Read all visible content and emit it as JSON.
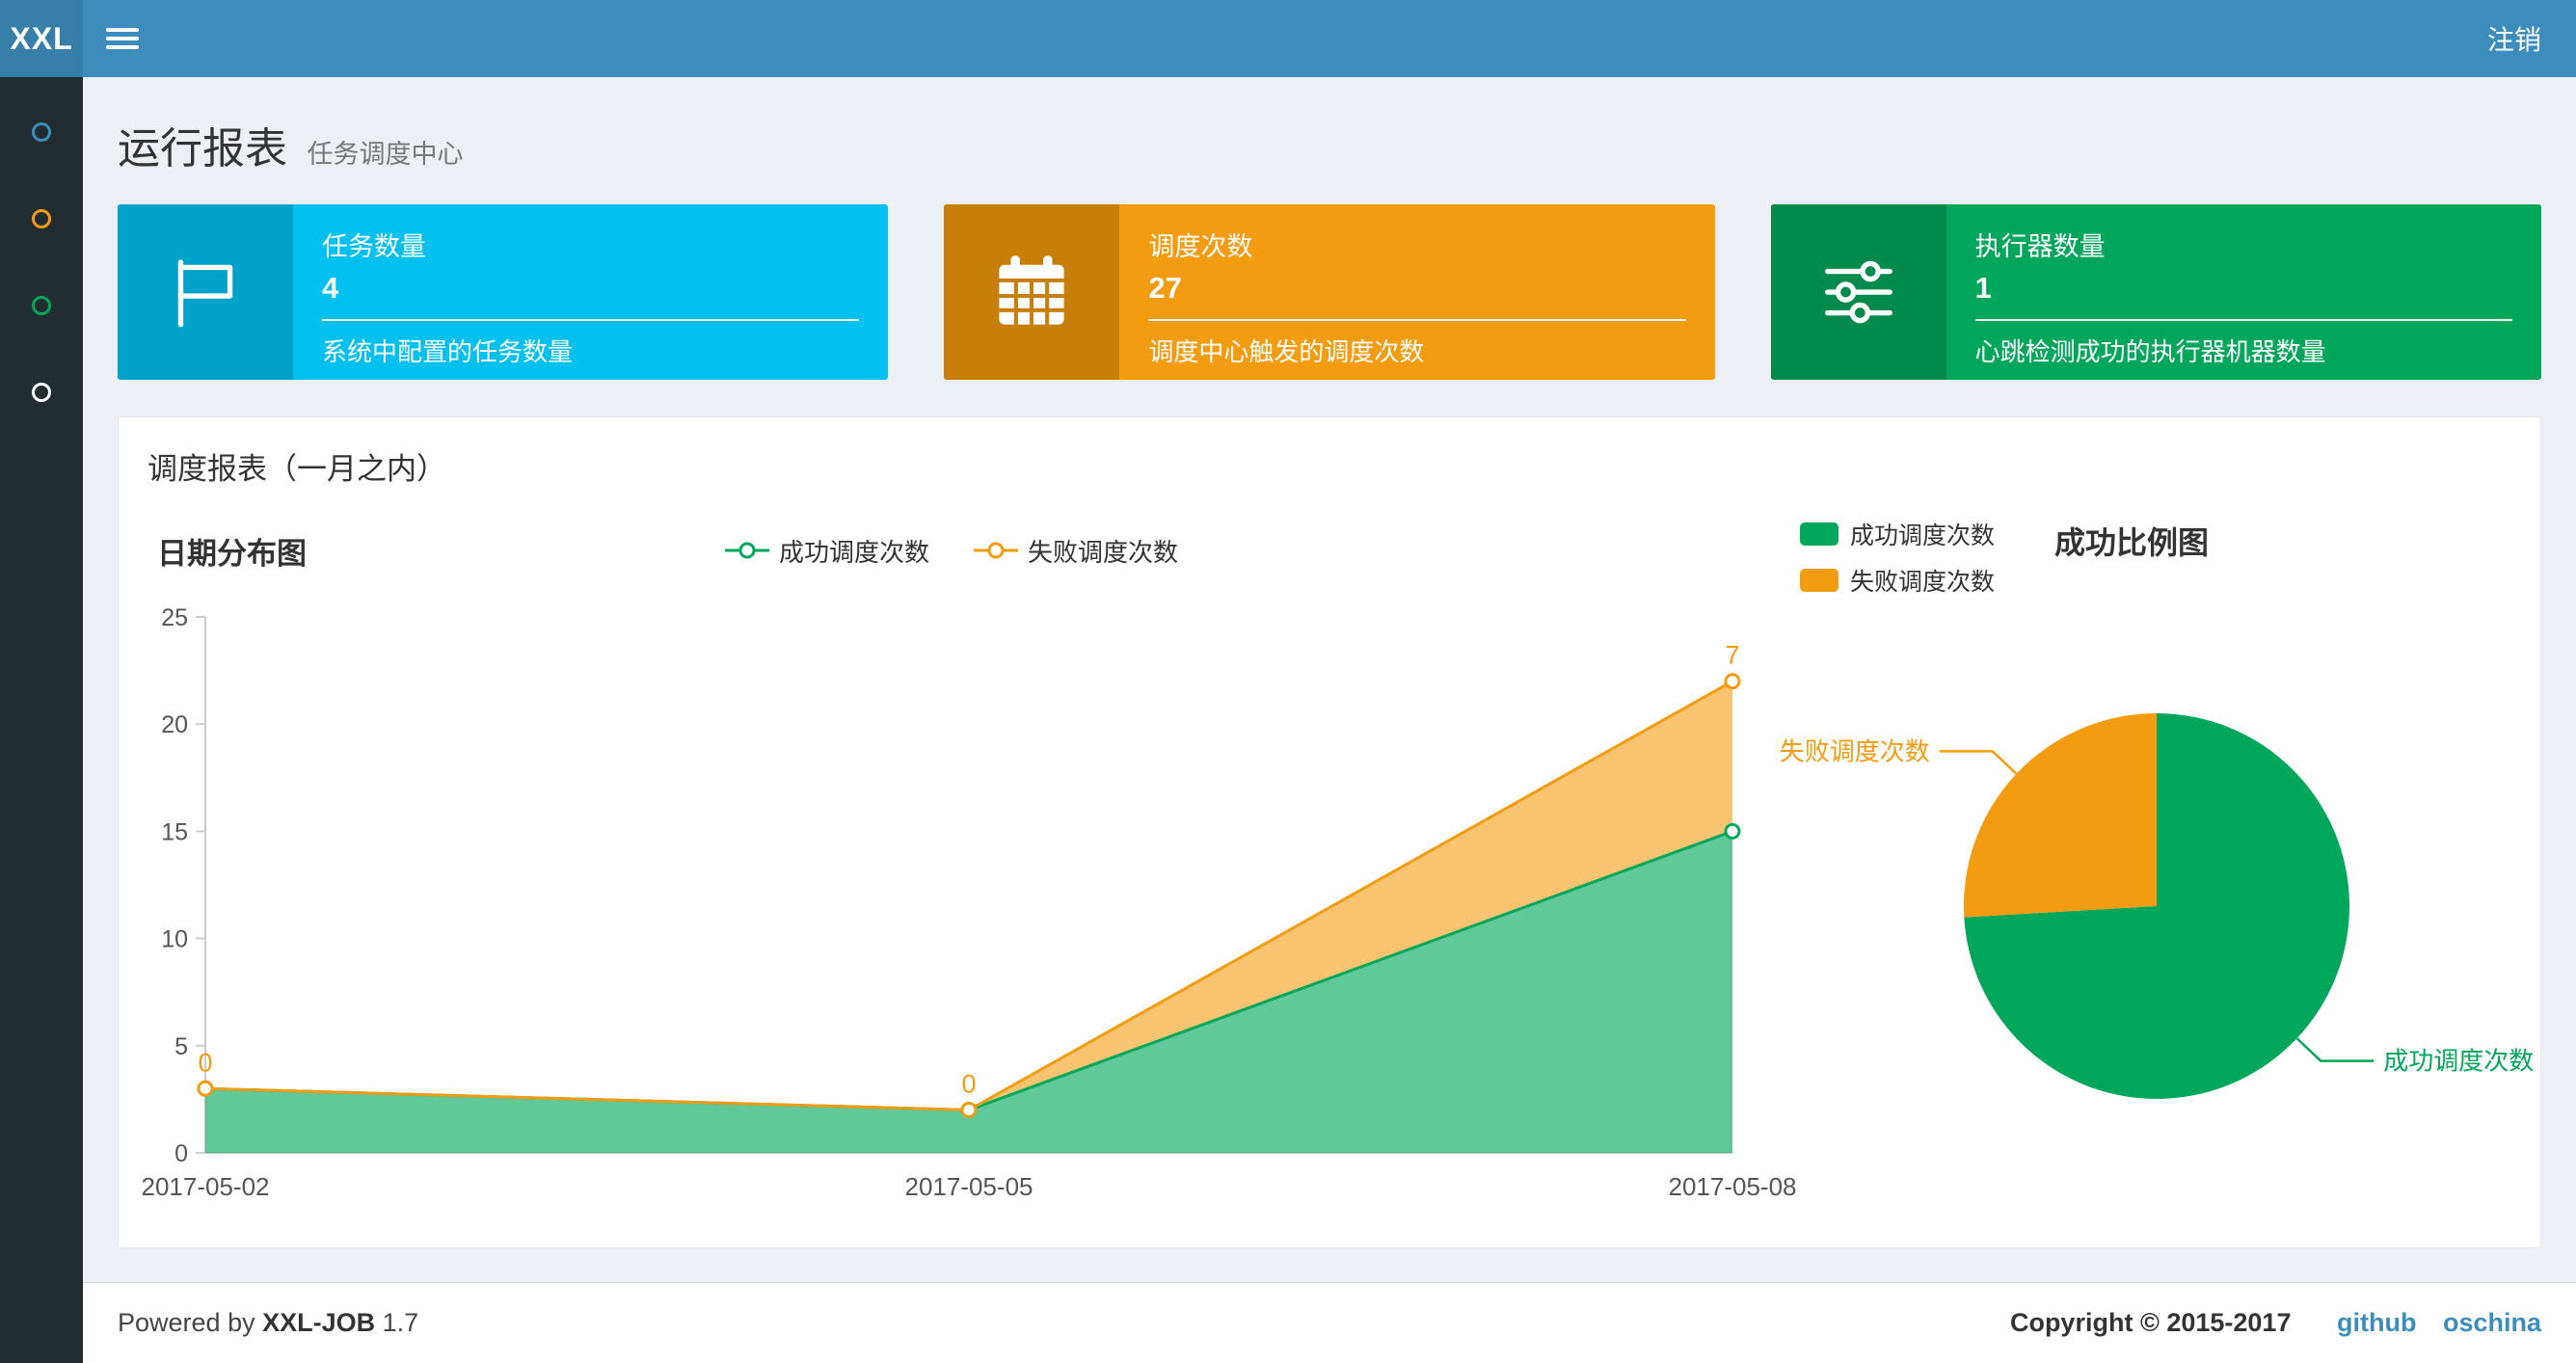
{
  "navbar": {
    "logo": "XXL",
    "logout_label": "注销"
  },
  "sidebar": {
    "items": [
      {
        "id": "menu-1",
        "color": "#3c8dbc"
      },
      {
        "id": "menu-2",
        "color": "#f39c12"
      },
      {
        "id": "menu-3",
        "color": "#00a65a"
      },
      {
        "id": "menu-4",
        "color": "#ffffff"
      }
    ]
  },
  "header": {
    "title": "运行报表",
    "subtitle": "任务调度中心"
  },
  "info_boxes": [
    {
      "label": "任务数量",
      "value": "4",
      "desc": "系统中配置的任务数量",
      "color": "#00c0ef",
      "color_dark": "#00a2ca",
      "icon": "flag-icon"
    },
    {
      "label": "调度次数",
      "value": "27",
      "desc": "调度中心触发的调度次数",
      "color": "#f39c12",
      "color_dark": "#c87f0a",
      "icon": "calendar-icon"
    },
    {
      "label": "执行器数量",
      "value": "1",
      "desc": "心跳检测成功的执行器机器数量",
      "color": "#00a65a",
      "color_dark": "#008a4b",
      "icon": "sliders-icon"
    }
  ],
  "panel": {
    "title": "调度报表（一月之内）"
  },
  "chart_data": [
    {
      "type": "area",
      "title": "日期分布图",
      "stacked": true,
      "x": [
        "2017-05-02",
        "2017-05-05",
        "2017-05-08"
      ],
      "series": [
        {
          "name": "成功调度次数",
          "color": "#00a65a",
          "values": [
            3,
            2,
            15
          ]
        },
        {
          "name": "失败调度次数",
          "color": "#f39c12",
          "values": [
            0,
            0,
            7
          ],
          "point_labels": [
            "0",
            "0",
            "7"
          ]
        }
      ],
      "ylim": [
        0,
        25
      ],
      "yticks": [
        0,
        5,
        10,
        15,
        20,
        25
      ],
      "legend_position": "top-center",
      "grid": false
    },
    {
      "type": "pie",
      "title": "成功比例图",
      "slices": [
        {
          "name": "成功调度次数",
          "value": 20,
          "color": "#00a65a"
        },
        {
          "name": "失败调度次数",
          "value": 7,
          "color": "#f39c12"
        }
      ],
      "legend_position": "top-left"
    }
  ],
  "footer": {
    "powered_by": "Powered by",
    "brand": "XXL-JOB",
    "version": "1.7",
    "copyright": "Copyright © 2015-2017",
    "links": [
      {
        "label": "github"
      },
      {
        "label": "oschina"
      }
    ]
  }
}
